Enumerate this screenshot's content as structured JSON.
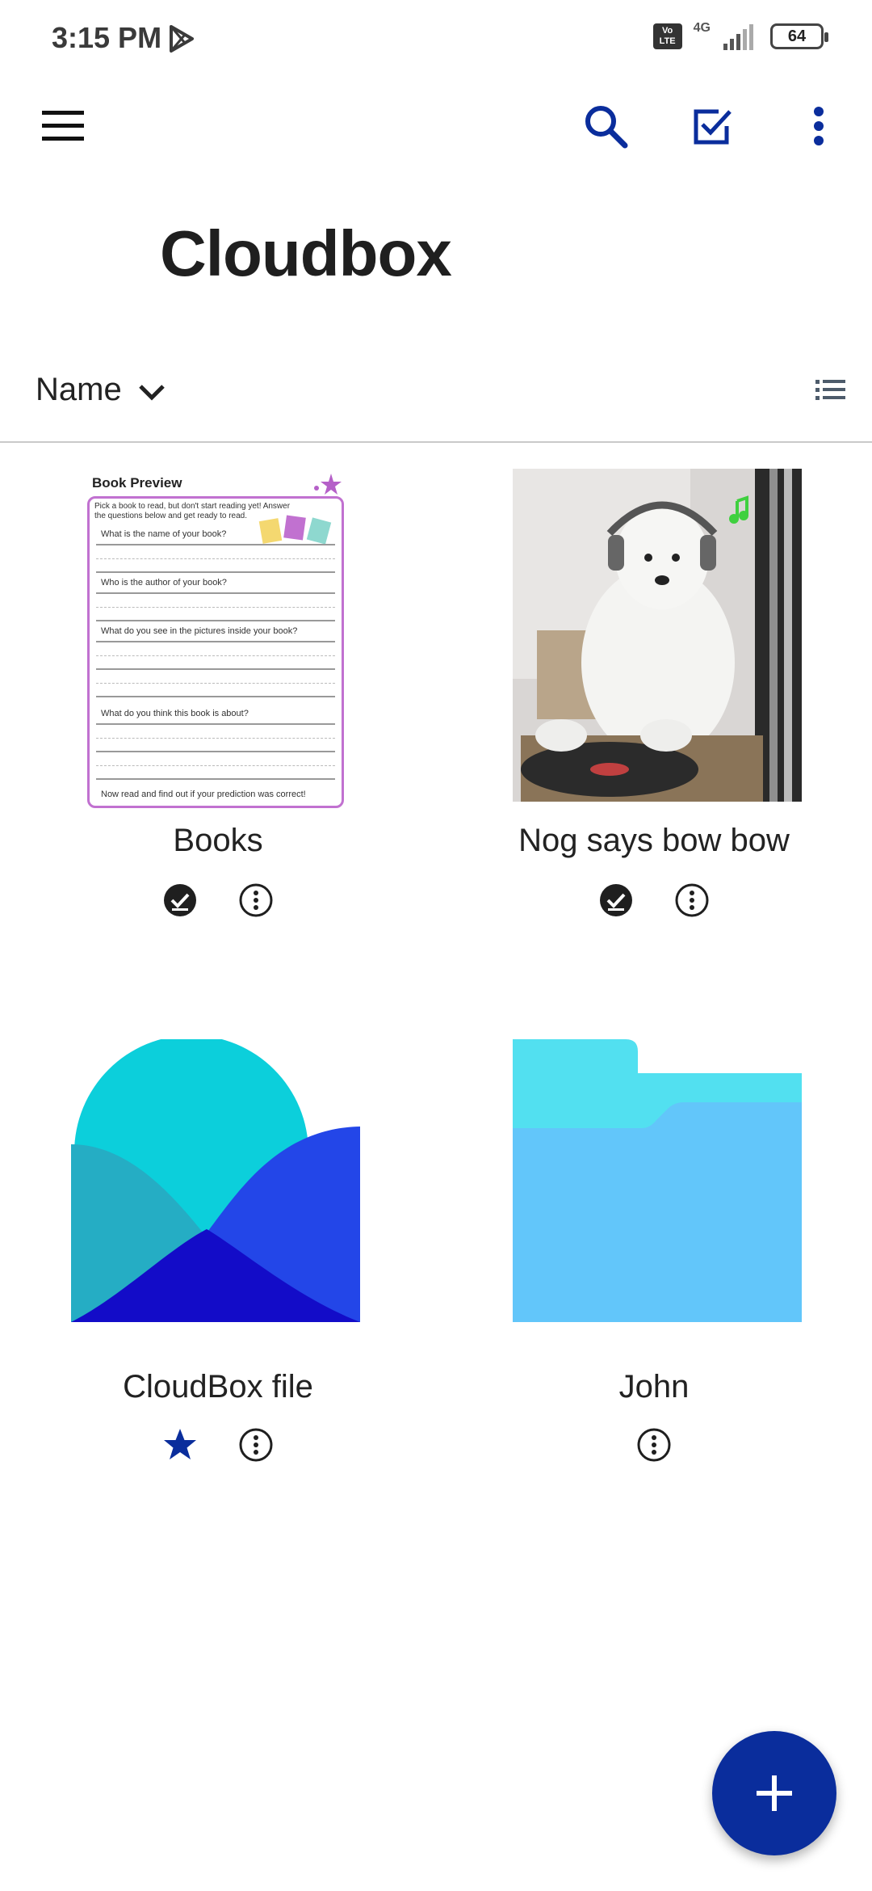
{
  "status_bar": {
    "time": "3:15 PM",
    "volte": "Vo LTE",
    "network": "4G",
    "battery": "64"
  },
  "app_bar": {
    "menu_icon": "hamburger-menu-icon",
    "search_icon": "search-icon",
    "select_icon": "checkbox-icon",
    "more_icon": "more-vert-icon"
  },
  "page": {
    "title": "Cloudbox"
  },
  "sort": {
    "label": "Name"
  },
  "items": [
    {
      "name": "Books",
      "type": "image",
      "icons": [
        "check-circle-icon",
        "more-circle-icon"
      ]
    },
    {
      "name": "Nog says bow bow",
      "type": "image",
      "icons": [
        "check-circle-icon",
        "more-circle-icon"
      ]
    },
    {
      "name": "CloudBox file",
      "type": "file",
      "icons": [
        "star-icon",
        "more-circle-icon"
      ]
    },
    {
      "name": "John",
      "type": "folder",
      "icons": [
        "more-circle-icon"
      ]
    }
  ],
  "book_preview": {
    "title": "Book Preview",
    "intro": "Pick a book to read, but don't start reading yet! Answer the questions below and get ready to read.",
    "q1": "What is the name of your book?",
    "q2": "Who is the author of your book?",
    "q3": "What do you see in the pictures inside your book?",
    "q4": "What do you think this book is about?",
    "footer": "Now read and find out if your prediction was correct!"
  },
  "colors": {
    "accent": "#0a2d9c",
    "folder_back": "#52e0f0",
    "folder_front": "#62c6fa",
    "logo_cyan": "#0ccfdb",
    "logo_teal": "#25adc4",
    "logo_blue": "#2346e8",
    "logo_navy": "#130cc8"
  },
  "fab": {
    "icon": "plus-icon"
  }
}
